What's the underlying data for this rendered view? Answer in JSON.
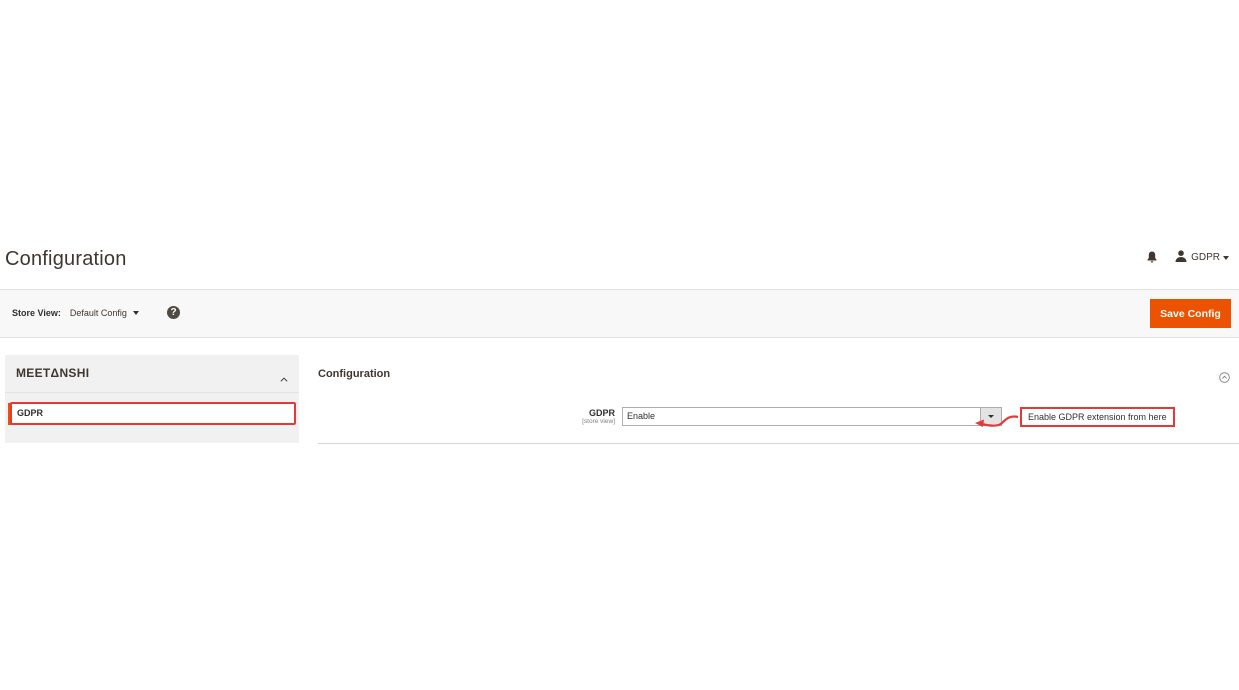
{
  "header": {
    "title": "Configuration",
    "user_label": "GDPR",
    "icons": {
      "notifications": "bell-icon",
      "user": "user-icon"
    }
  },
  "toolbar": {
    "store_view_label": "Store View:",
    "store_view_value": "Default Config",
    "help_icon": "question-icon",
    "save_label": "Save Config"
  },
  "sidebar": {
    "group_title": "MEETΔNSHI",
    "items": [
      {
        "label": "GDPR",
        "active": true
      }
    ]
  },
  "main": {
    "section_title": "Configuration",
    "fields": [
      {
        "label": "GDPR",
        "scope": "[store view]",
        "value": "Enable"
      }
    ],
    "annotation": "Enable GDPR extension from here"
  },
  "colors": {
    "accent": "#eb5202",
    "highlight": "#e53939",
    "text": "#303030"
  }
}
